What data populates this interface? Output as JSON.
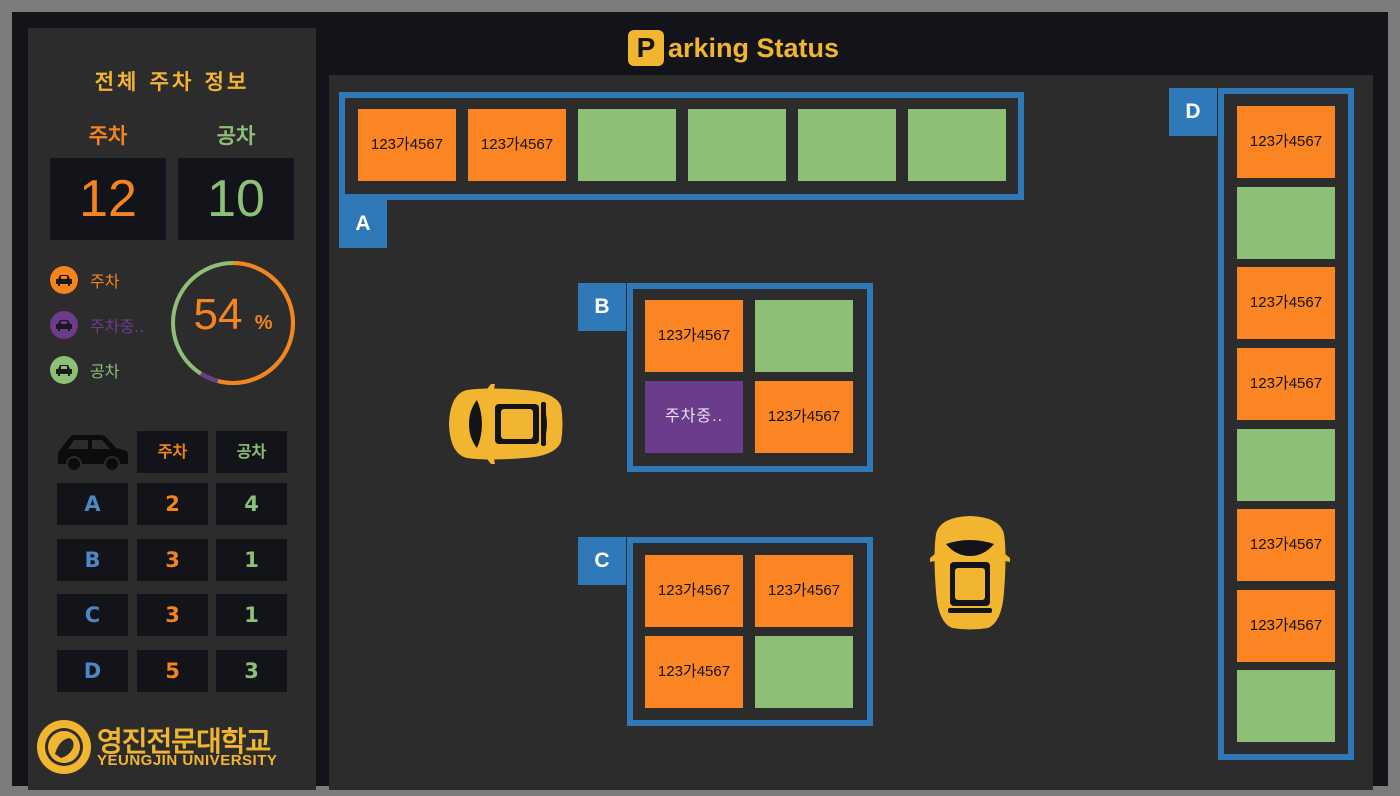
{
  "header": {
    "title_letter": "P",
    "title_rest": "arking Status"
  },
  "sidebar": {
    "title": "전체 주차 정보",
    "parked_label": "주차",
    "empty_label": "공차",
    "parked_count": "12",
    "empty_count": "10",
    "legend": [
      {
        "label": "주차",
        "color": "#f5841f"
      },
      {
        "label": "주차중..",
        "color": "#6b3c8c"
      },
      {
        "label": "공차",
        "color": "#8ebf76"
      }
    ],
    "occupancy_percent": "54",
    "percent_sign": "%",
    "table": {
      "col_parked": "주차",
      "col_empty": "공차",
      "rows": [
        {
          "zone": "A",
          "parked": "2",
          "empty": "4"
        },
        {
          "zone": "B",
          "parked": "3",
          "empty": "1"
        },
        {
          "zone": "C",
          "parked": "3",
          "empty": "1"
        },
        {
          "zone": "D",
          "parked": "5",
          "empty": "3"
        }
      ]
    },
    "logo": {
      "name_ko": "영진전문대학교",
      "name_en": "YEUNGJIN UNIVERSITY"
    }
  },
  "zones": {
    "A": {
      "label": "A",
      "slots": [
        "123가4567",
        "123가4567",
        "",
        "",
        "",
        ""
      ]
    },
    "B": {
      "label": "B",
      "slots": [
        "123가4567",
        "",
        "주차중..",
        "123가4567"
      ]
    },
    "C": {
      "label": "C",
      "slots": [
        "123가4567",
        "123가4567",
        "123가4567",
        ""
      ]
    },
    "D": {
      "label": "D",
      "slots": [
        "123가4567",
        "",
        "123가4567",
        "123가4567",
        "",
        "123가4567",
        "123가4567",
        ""
      ]
    }
  },
  "colors": {
    "occupied": "#fb8522",
    "empty": "#8ebf76",
    "parking": "#6b3c8c",
    "zone_frame": "#2f79b8",
    "accent": "#f2b530"
  }
}
